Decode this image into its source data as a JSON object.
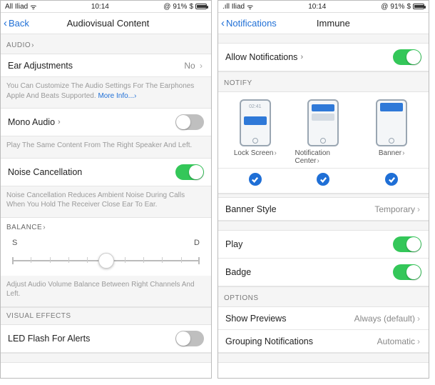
{
  "statusbar": {
    "carrier": "All Iliad",
    "carrier_alt": ".ıll Iliad",
    "time": "10:14",
    "battery": "91%"
  },
  "left": {
    "nav": {
      "back": "Back",
      "title": "Audiovisual Content"
    },
    "audio_header": "AUDIO",
    "ear": {
      "label": "Ear Adjustments",
      "value": "No",
      "desc": "You Can Customize The Audio Settings For The Earphones Apple And Beats Supported.",
      "more": "More Info...›"
    },
    "mono": {
      "label": "Mono Audio",
      "desc": "Play The Same Content From The Right Speaker And Left."
    },
    "noise": {
      "label": "Noise Cancellation",
      "desc": "Noise Cancellation Reduces Ambient Noise During Calls When You Hold The Receiver Close Ear To Ear."
    },
    "balance": {
      "header": "BALANCE",
      "left": "S",
      "right": "D",
      "desc": "Adjust Audio Volume Balance Between Right Channels And Left."
    },
    "visual_header": "VISUAL EFFECTS",
    "led": {
      "label": "LED Flash For Alerts"
    }
  },
  "right": {
    "nav": {
      "back": "Notifications",
      "title": "Immune"
    },
    "allow": {
      "label": "Allow Notifications"
    },
    "notify_header": "NOTIFY",
    "phones": {
      "lock": "Lock Screen",
      "center": "Notification Center",
      "banner": "Banner",
      "lock_time": "02:41"
    },
    "banner_style": {
      "label": "Banner Style",
      "value": "Temporary"
    },
    "play": {
      "label": "Play"
    },
    "badge": {
      "label": "Badge"
    },
    "options_header": "OPTIONS",
    "previews": {
      "label": "Show Previews",
      "value": "Always (default)"
    },
    "grouping": {
      "label": "Grouping Notifications",
      "value": "Automatic"
    }
  }
}
